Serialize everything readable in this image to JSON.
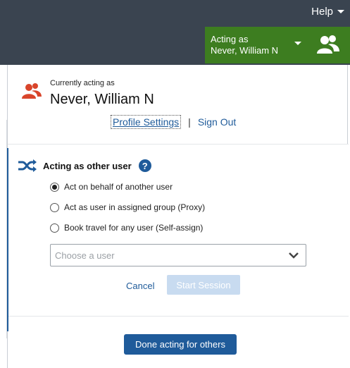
{
  "header": {
    "help_label": "Help",
    "acting_line1": "Acting as",
    "acting_line2": "Never, William N"
  },
  "current": {
    "label": "Currently acting as",
    "name": "Never, William N",
    "profile_link": "Profile Settings",
    "separator": "|",
    "signout_link": "Sign Out"
  },
  "other": {
    "title": "Acting as other user",
    "help_glyph": "?",
    "options": [
      {
        "label": "Act on behalf of another user",
        "checked": true
      },
      {
        "label": "Act as user in assigned group (Proxy)",
        "checked": false
      },
      {
        "label": "Book travel for any user (Self-assign)",
        "checked": false
      }
    ],
    "select_placeholder": "Choose a user",
    "cancel_label": "Cancel",
    "start_label": "Start Session"
  },
  "footer": {
    "done_label": "Done acting for others"
  },
  "colors": {
    "header_bg": "#3a4450",
    "acting_bg": "#3d7d20",
    "primary_blue": "#1f5b9a",
    "disabled_blue": "#c8dbf0",
    "user_icon_red": "#d9452b"
  },
  "icons": {
    "header_user": "users-icon",
    "current_user": "users-icon",
    "other": "shuffle-icon",
    "help": "help-circle-icon",
    "select": "chevron-down-icon"
  }
}
